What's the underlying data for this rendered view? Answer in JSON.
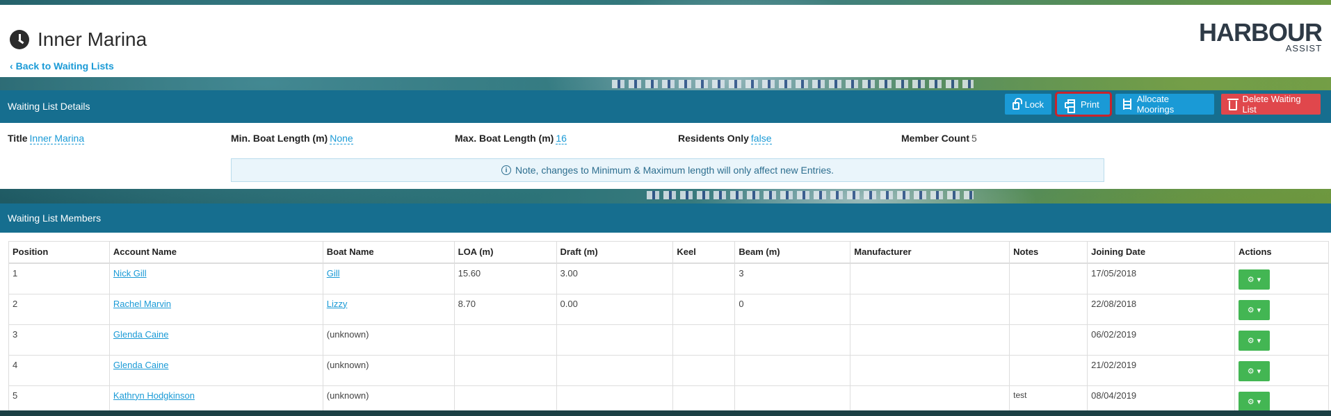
{
  "header": {
    "title": "Inner Marina",
    "back_link": "Back to Waiting Lists",
    "logo_main": "HARBOUR",
    "logo_sub": "ASSIST"
  },
  "details": {
    "heading": "Waiting List Details",
    "buttons": {
      "lock": "Lock",
      "print": "Print",
      "allocate": "Allocate Moorings",
      "delete": "Delete Waiting List"
    },
    "fields": {
      "title_label": "Title",
      "title_value": "Inner Marina",
      "min_label": "Min. Boat Length (m)",
      "min_value": "None",
      "max_label": "Max. Boat Length (m)",
      "max_value": "16",
      "residents_label": "Residents Only",
      "residents_value": "false",
      "member_count_label": "Member Count",
      "member_count_value": "5"
    },
    "note": "Note, changes to Minimum & Maximum length will only affect new Entries."
  },
  "members": {
    "heading": "Waiting List Members",
    "columns": [
      "Position",
      "Account Name",
      "Boat Name",
      "LOA (m)",
      "Draft (m)",
      "Keel",
      "Beam (m)",
      "Manufacturer",
      "Notes",
      "Joining Date",
      "Actions"
    ],
    "rows": [
      {
        "position": "1",
        "account": "Nick Gill",
        "boat": "Gill",
        "boat_link": true,
        "loa": "15.60",
        "draft": "3.00",
        "keel": "",
        "beam": "3",
        "manufacturer": "",
        "notes": "",
        "joining": "17/05/2018"
      },
      {
        "position": "2",
        "account": "Rachel Marvin",
        "boat": "Lizzy",
        "boat_link": true,
        "loa": "8.70",
        "draft": "0.00",
        "keel": "",
        "beam": "0",
        "manufacturer": "",
        "notes": "",
        "joining": "22/08/2018"
      },
      {
        "position": "3",
        "account": "Glenda Caine",
        "boat": "(unknown)",
        "boat_link": false,
        "loa": "",
        "draft": "",
        "keel": "",
        "beam": "",
        "manufacturer": "",
        "notes": "",
        "joining": "06/02/2019"
      },
      {
        "position": "4",
        "account": "Glenda Caine",
        "boat": "(unknown)",
        "boat_link": false,
        "loa": "",
        "draft": "",
        "keel": "",
        "beam": "",
        "manufacturer": "",
        "notes": "",
        "joining": "21/02/2019"
      },
      {
        "position": "5",
        "account": "Kathryn Hodgkinson",
        "boat": "(unknown)",
        "boat_link": false,
        "loa": "",
        "draft": "",
        "keel": "",
        "beam": "",
        "manufacturer": "",
        "notes": "test",
        "joining": "08/04/2019"
      }
    ]
  },
  "colors": {
    "panel_header": "#166e8f",
    "link": "#1a9ad6",
    "danger": "#e0474c",
    "success": "#43b653",
    "highlight": "#c8232b"
  }
}
